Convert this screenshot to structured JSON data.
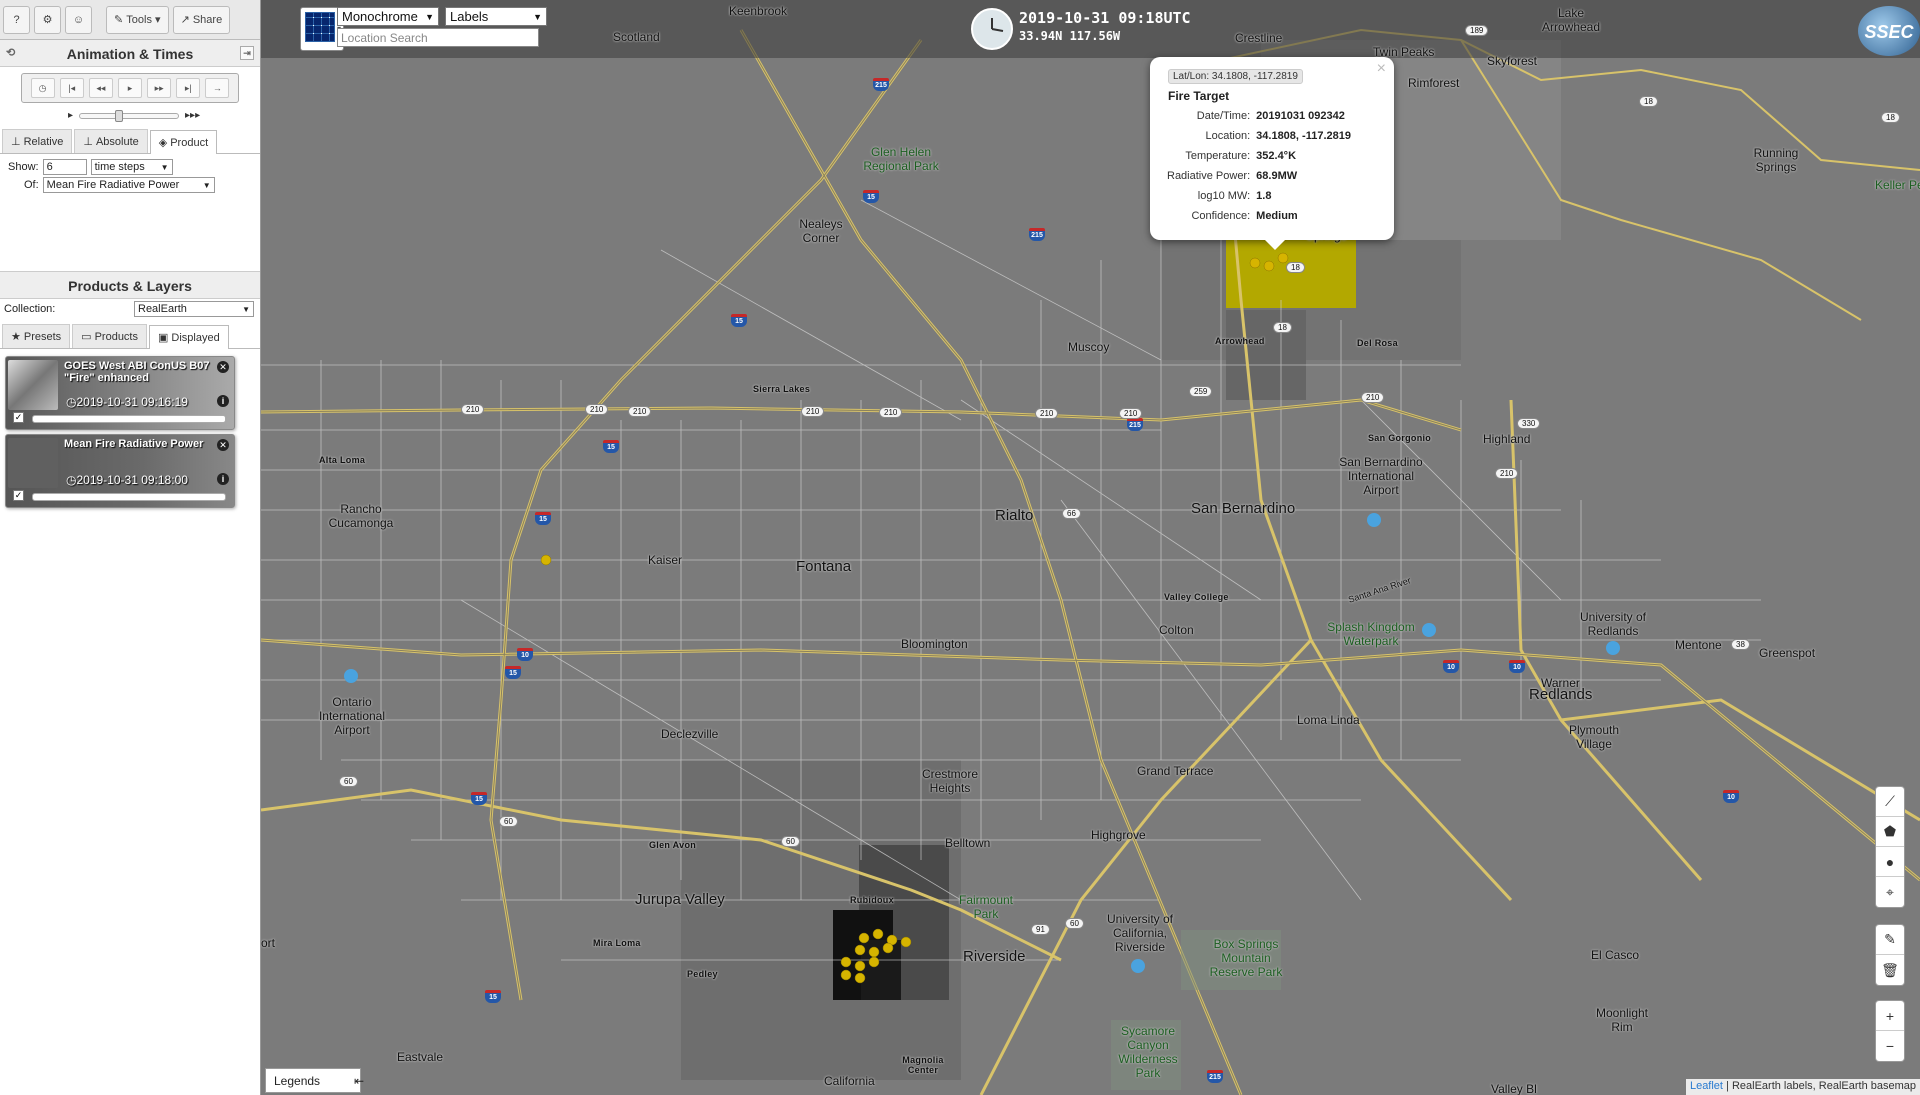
{
  "toolbar": {
    "help": "?",
    "tools": "Tools",
    "share": "Share"
  },
  "animation": {
    "title": "Animation & Times",
    "tabs": [
      "Relative",
      "Absolute",
      "Product"
    ],
    "show_label": "Show:",
    "show_value": "6",
    "steps_option": "time steps",
    "of_label": "Of:",
    "of_value": "Mean Fire Radiative Power"
  },
  "products": {
    "title": "Products & Layers",
    "collection_label": "Collection:",
    "collection_value": "RealEarth",
    "tabs": [
      "Presets",
      "Products",
      "Displayed"
    ]
  },
  "layers": [
    {
      "title": "GOES West ABI ConUS B07 \"Fire\" enhanced",
      "time": "2019-10-31 09:16:19"
    },
    {
      "title": "Mean Fire Radiative Power",
      "time": "2019-10-31 09:18:00"
    }
  ],
  "map": {
    "base_select": "Monochrome",
    "labels_select": "Labels",
    "search_placeholder": "Location Search",
    "datetime": "2019-10-31 09:18UTC",
    "coords": "33.94N 117.56W",
    "legends": "Legends",
    "attribution_link": "Leaflet",
    "attribution_text": " | RealEarth labels, RealEarth basemap",
    "logo": "SSEC",
    "zoom_in": "+",
    "zoom_out": "−"
  },
  "popup": {
    "latlon": "Lat/Lon: 34.1808, -117.2819",
    "title": "Fire Target",
    "close": "×",
    "rows": [
      {
        "k": "Date/Time:",
        "v": "20191031 092342"
      },
      {
        "k": "Location:",
        "v": "34.1808, -117.2819"
      },
      {
        "k": "Temperature:",
        "v": "352.4°K"
      },
      {
        "k": "Radiative Power:",
        "v": "68.9MW"
      },
      {
        "k": "log10 MW:",
        "v": "1.8"
      },
      {
        "k": "Confidence:",
        "v": "Medium"
      }
    ]
  },
  "places": [
    "Keenbrook",
    "Scotland",
    "Crestline",
    "Twin Peaks",
    "Rimforest",
    "Skyforest",
    "Lake Arrowhead",
    "Running Springs",
    "Keller Pe",
    "Glen Helen Regional Park",
    "Nealeys Corner",
    "Muscoy",
    "Arrowhead",
    "Del Rosa",
    "Sierra Lakes",
    "Alta Loma",
    "Rancho Cucamonga",
    "Kaiser",
    "Fontana",
    "Rialto",
    "San Bernardino",
    "San Gorgonio",
    "Highland",
    "San Bernardino International Airport",
    "Valley College",
    "Colton",
    "Splash Kingdom Waterpark",
    "University of Redlands",
    "Mentone",
    "Greenspot",
    "Bloomington",
    "Ontario International Airport",
    "Loma Linda",
    "Redlands",
    "Warner",
    "Plymouth Village",
    "Declezville",
    "Crestmore Heights",
    "Grand Terrace",
    "Glen Avon",
    "Belltown",
    "Highgrove",
    "Jurupa Valley",
    "Rubidoux",
    "Fairmount Park",
    "Mira Loma",
    "Pedley",
    "Riverside",
    "University of California, Riverside",
    "Box Springs Mountain Reserve Park",
    "El Casco",
    "Moonlight Rim",
    "Eastvale",
    "Magnolia Center",
    "California",
    "Sycamore Canyon Wilderness Park",
    "Valley Bl",
    "ort",
    "Santa Ana River",
    "Springs"
  ],
  "colors": {
    "fire_dot": "#d6b400",
    "hot_pixel": "#b8a800",
    "road": "#d8c36a"
  }
}
